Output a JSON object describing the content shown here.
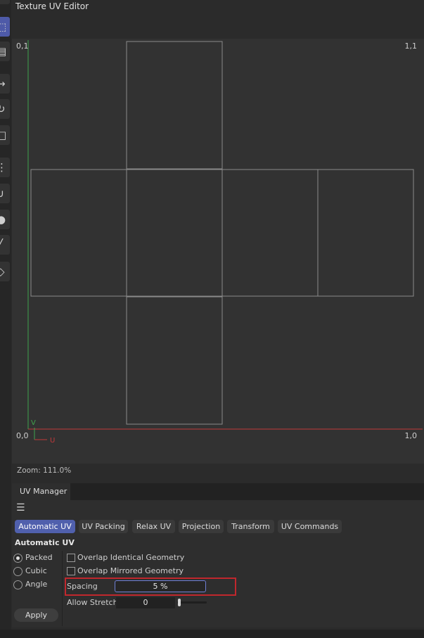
{
  "window": {
    "title": "Texture UV Editor"
  },
  "toolbar": {
    "tools": [
      {
        "icon": "select-rect-icon"
      },
      {
        "icon": "uv-polygon-icon"
      },
      {
        "icon": "move-icon"
      },
      {
        "icon": "rotate-icon"
      },
      {
        "icon": "scale-icon"
      },
      {
        "icon": "uv-mirror-icon"
      },
      {
        "icon": "magnet-icon"
      },
      {
        "icon": "loop-icon"
      },
      {
        "icon": "knife-icon"
      },
      {
        "icon": "projection-icon"
      }
    ]
  },
  "viewport": {
    "corner_top_left": "0,1",
    "corner_top_right": "1,1",
    "corner_bottom_left": "0,0",
    "corner_bottom_right": "1,0",
    "axis_v_label": "V",
    "axis_u_label": "U",
    "zoom_text": "Zoom: 111.0%",
    "colors": {
      "v_axis": "#3fa34d",
      "u_axis": "#c0393b",
      "uv_lines": "#8a8a8a"
    }
  },
  "uv_manager": {
    "tab_label": "UV Manager",
    "subtabs": [
      {
        "label": "Automatic UV",
        "active": true
      },
      {
        "label": "UV Packing",
        "active": false
      },
      {
        "label": "Relax UV",
        "active": false
      },
      {
        "label": "Projection",
        "active": false
      },
      {
        "label": "Transform",
        "active": false
      },
      {
        "label": "UV Commands",
        "active": false
      }
    ],
    "section_title": "Automatic UV",
    "modes": [
      {
        "label": "Packed",
        "selected": true
      },
      {
        "label": "Cubic",
        "selected": false
      },
      {
        "label": "Angle",
        "selected": false
      }
    ],
    "options": [
      {
        "label": "Overlap Identical Geometry",
        "checked": false
      },
      {
        "label": "Overlap Mirrored Geometry",
        "checked": false
      }
    ],
    "spacing_label": "Spacing",
    "spacing_value": "5 %",
    "allow_stretch_label": "Allow Stretch",
    "allow_stretch_value": "0",
    "allow_stretch_fraction": 0,
    "apply_label": "Apply",
    "accent_color": "#5060ad",
    "highlight_color": "#c0272d"
  }
}
